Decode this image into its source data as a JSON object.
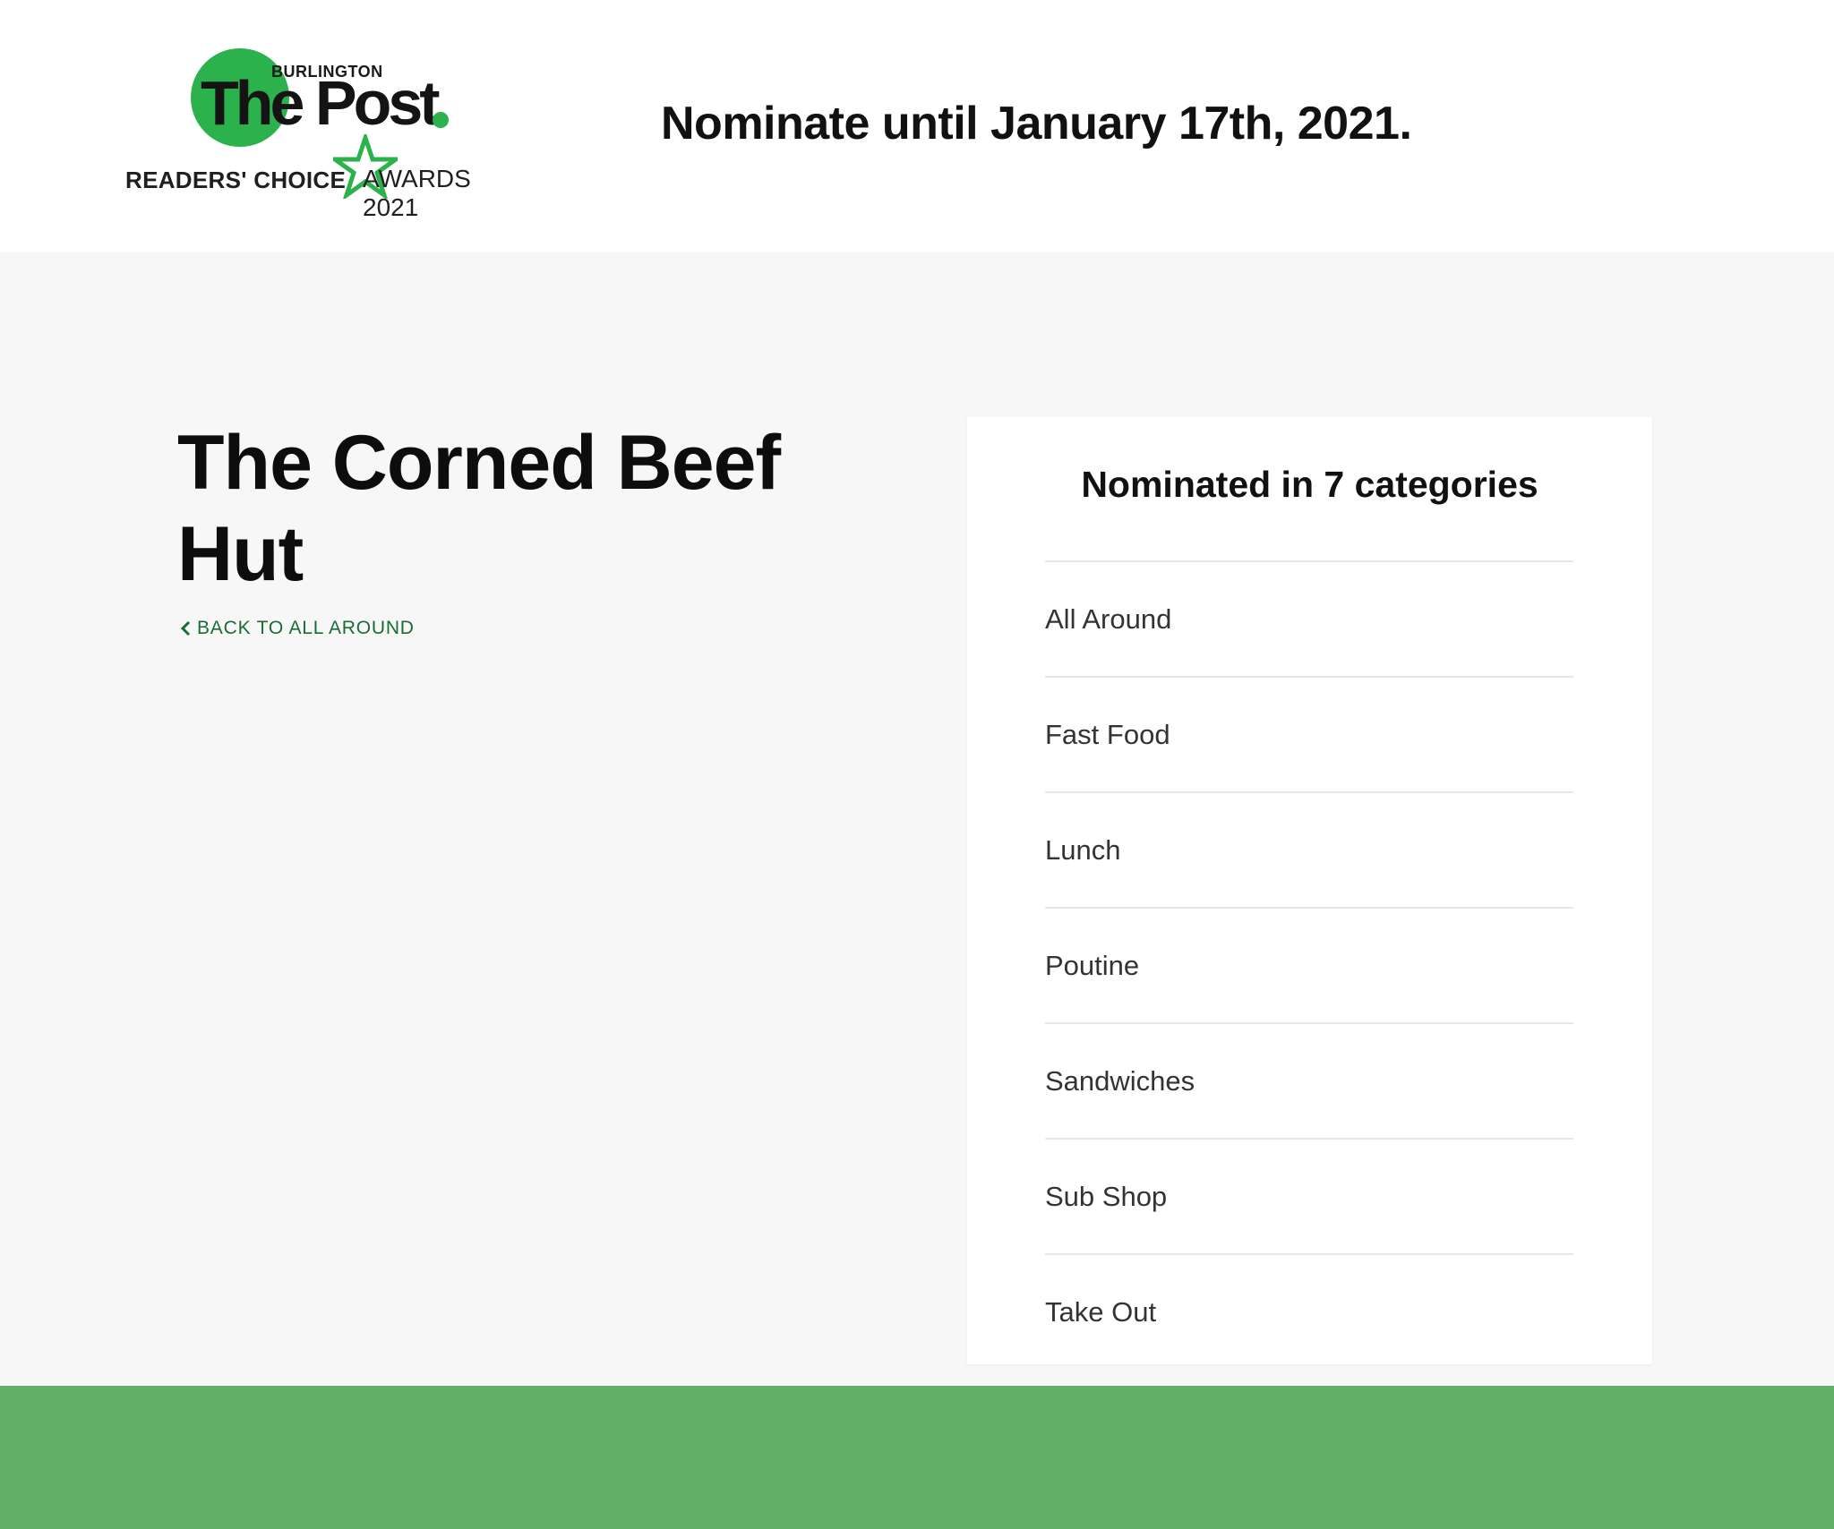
{
  "header": {
    "logo": {
      "burlington": "BURLINGTON",
      "the_post": "The Post",
      "readers_choice": "READERS' CHOICE",
      "awards": "AWARDS 2021",
      "brand_green": "#2bb24c"
    },
    "deadline": "Nominate until January 17th, 2021."
  },
  "main": {
    "business_name": "The Corned Beef Hut",
    "back_link": "BACK TO ALL AROUND",
    "back_icon": "chevron-left-icon"
  },
  "nominations": {
    "title": "Nominated in 7 categories",
    "categories": [
      {
        "label": "All Around"
      },
      {
        "label": "Fast Food"
      },
      {
        "label": "Lunch"
      },
      {
        "label": "Poutine"
      },
      {
        "label": "Sandwiches"
      },
      {
        "label": "Sub Shop"
      },
      {
        "label": "Take Out"
      }
    ]
  },
  "colors": {
    "accent_link": "#1b6b36",
    "footer_green": "#61b068",
    "page_bg": "#f7f7f7"
  }
}
